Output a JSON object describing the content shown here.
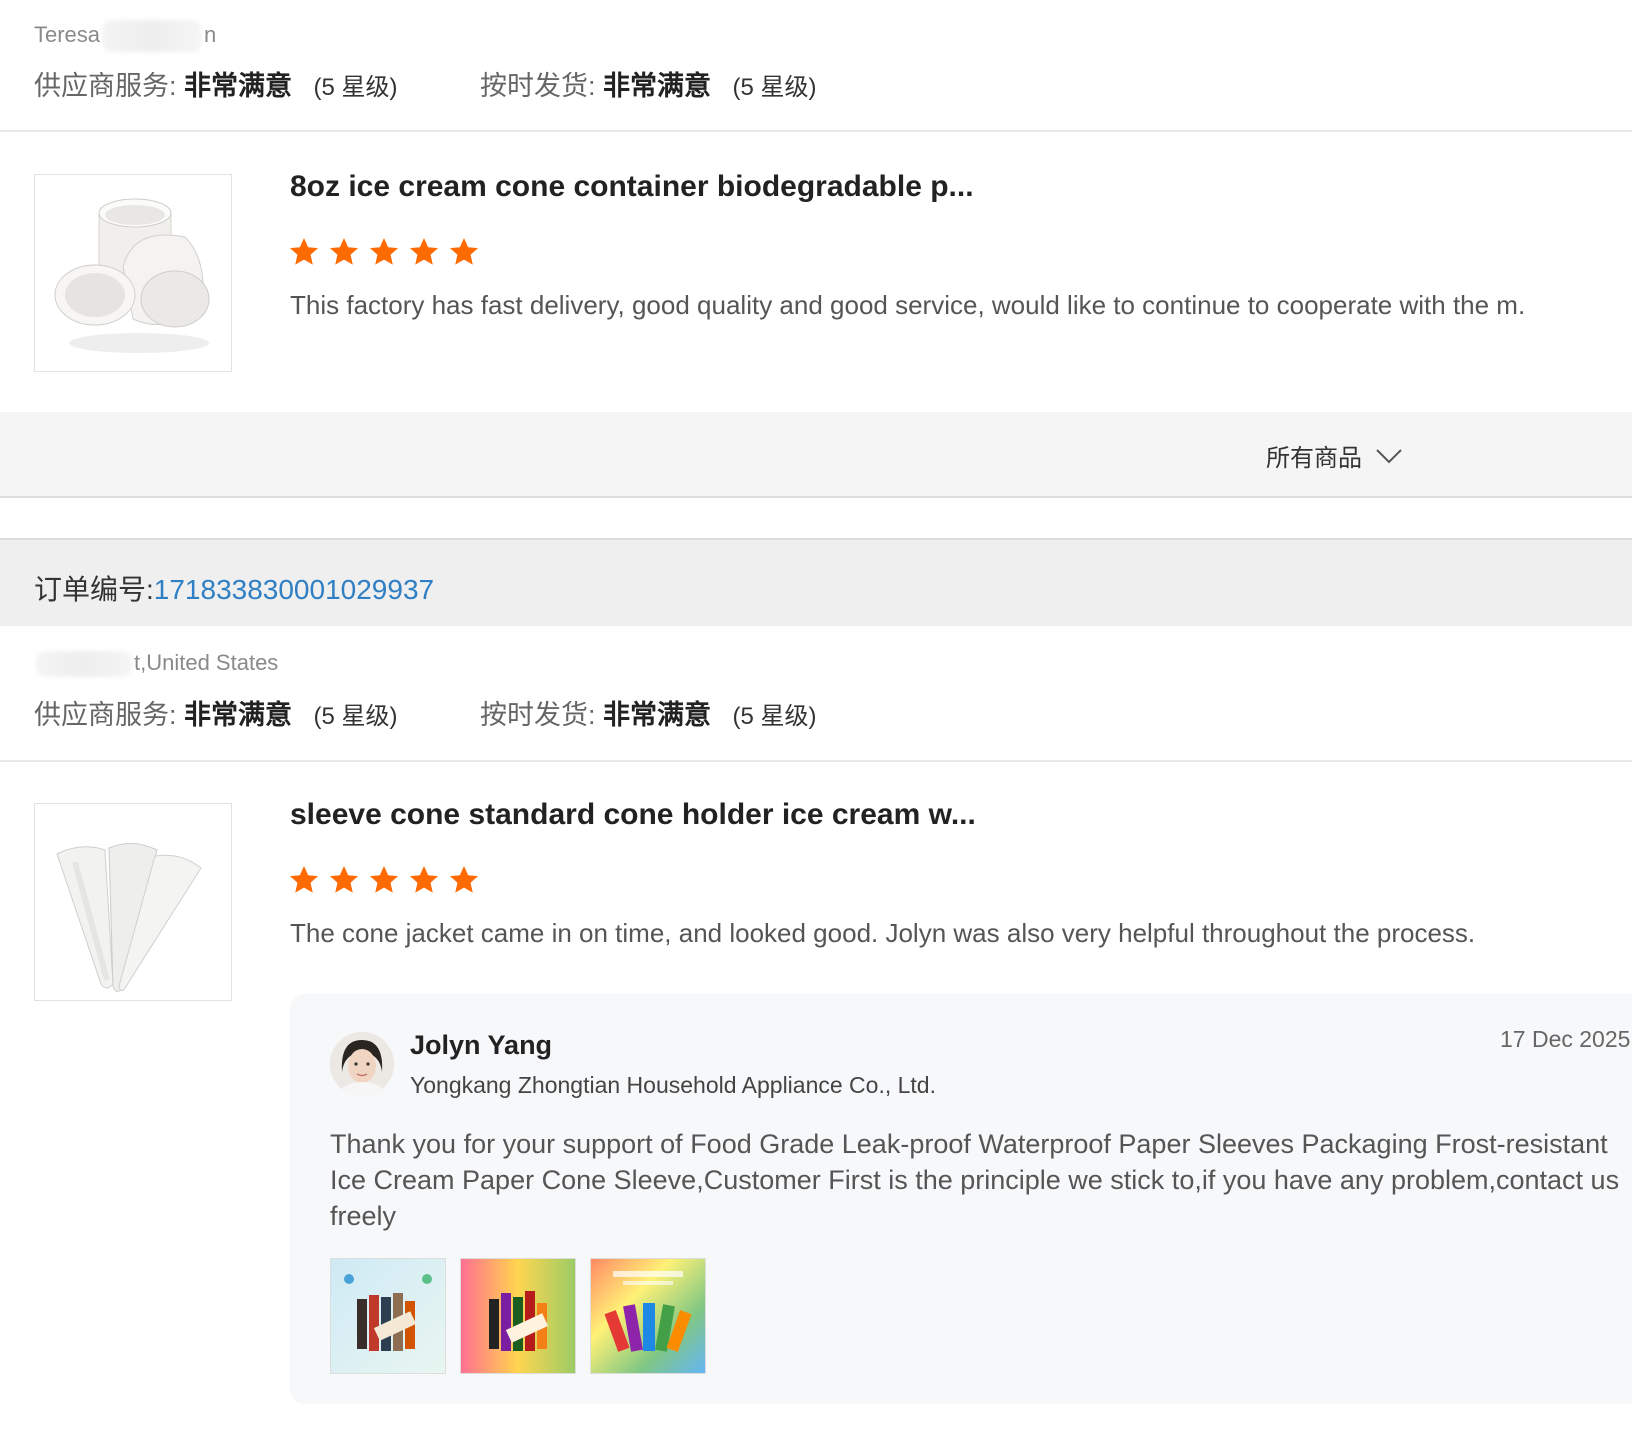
{
  "review1": {
    "buyer_prefix": "Teresa",
    "buyer_suffix": "n",
    "supplier_service_label": "供应商服务:",
    "supplier_service_value": "非常满意",
    "supplier_service_stars": "(5 星级)",
    "on_time_label": "按时发货:",
    "on_time_value": "非常满意",
    "on_time_stars": "(5 星级)",
    "product_title": "8oz ice cream cone container biodegradable p...",
    "rating": 5,
    "text": "This factory has fast delivery, good quality and good service, would like to continue to cooperate with the m."
  },
  "all_goods": {
    "label": "所有商品"
  },
  "order": {
    "label": "订单编号:",
    "number": "171833830001029937"
  },
  "review2": {
    "location": "t,United States",
    "supplier_service_label": "供应商服务:",
    "supplier_service_value": "非常满意",
    "supplier_service_stars": "(5 星级)",
    "on_time_label": "按时发货:",
    "on_time_value": "非常满意",
    "on_time_stars": "(5 星级)",
    "product_title": "sleeve cone standard cone holder ice cream w...",
    "rating": 5,
    "text": "The cone jacket came in on time, and looked good. Jolyn was also very helpful throughout the process.",
    "reply": {
      "name": "Jolyn Yang",
      "company": "Yongkang Zhongtian Household Appliance Co., Ltd.",
      "date": "17 Dec 2025",
      "text": "Thank you for your support of Food Grade Leak-proof Waterproof Paper Sleeves Packaging Frost-resistant Ice Cream Paper Cone Sleeve,Customer First is the principle we stick to,if you have any problem,contact us freely"
    }
  },
  "colors": {
    "star": "#ff6a00",
    "order_link": "#2f7fc4"
  },
  "icons": {
    "star": "star-icon",
    "chevron": "chevron-down-icon"
  }
}
